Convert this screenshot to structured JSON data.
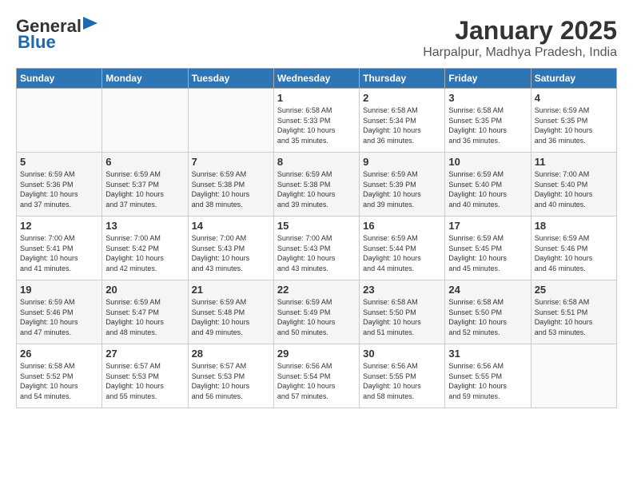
{
  "header": {
    "logo_line1": "General",
    "logo_line2": "Blue",
    "title": "January 2025",
    "subtitle": "Harpalpur, Madhya Pradesh, India"
  },
  "weekdays": [
    "Sunday",
    "Monday",
    "Tuesday",
    "Wednesday",
    "Thursday",
    "Friday",
    "Saturday"
  ],
  "weeks": [
    [
      {
        "day": "",
        "info": ""
      },
      {
        "day": "",
        "info": ""
      },
      {
        "day": "",
        "info": ""
      },
      {
        "day": "1",
        "info": "Sunrise: 6:58 AM\nSunset: 5:33 PM\nDaylight: 10 hours\nand 35 minutes."
      },
      {
        "day": "2",
        "info": "Sunrise: 6:58 AM\nSunset: 5:34 PM\nDaylight: 10 hours\nand 36 minutes."
      },
      {
        "day": "3",
        "info": "Sunrise: 6:58 AM\nSunset: 5:35 PM\nDaylight: 10 hours\nand 36 minutes."
      },
      {
        "day": "4",
        "info": "Sunrise: 6:59 AM\nSunset: 5:35 PM\nDaylight: 10 hours\nand 36 minutes."
      }
    ],
    [
      {
        "day": "5",
        "info": "Sunrise: 6:59 AM\nSunset: 5:36 PM\nDaylight: 10 hours\nand 37 minutes."
      },
      {
        "day": "6",
        "info": "Sunrise: 6:59 AM\nSunset: 5:37 PM\nDaylight: 10 hours\nand 37 minutes."
      },
      {
        "day": "7",
        "info": "Sunrise: 6:59 AM\nSunset: 5:38 PM\nDaylight: 10 hours\nand 38 minutes."
      },
      {
        "day": "8",
        "info": "Sunrise: 6:59 AM\nSunset: 5:38 PM\nDaylight: 10 hours\nand 39 minutes."
      },
      {
        "day": "9",
        "info": "Sunrise: 6:59 AM\nSunset: 5:39 PM\nDaylight: 10 hours\nand 39 minutes."
      },
      {
        "day": "10",
        "info": "Sunrise: 6:59 AM\nSunset: 5:40 PM\nDaylight: 10 hours\nand 40 minutes."
      },
      {
        "day": "11",
        "info": "Sunrise: 7:00 AM\nSunset: 5:40 PM\nDaylight: 10 hours\nand 40 minutes."
      }
    ],
    [
      {
        "day": "12",
        "info": "Sunrise: 7:00 AM\nSunset: 5:41 PM\nDaylight: 10 hours\nand 41 minutes."
      },
      {
        "day": "13",
        "info": "Sunrise: 7:00 AM\nSunset: 5:42 PM\nDaylight: 10 hours\nand 42 minutes."
      },
      {
        "day": "14",
        "info": "Sunrise: 7:00 AM\nSunset: 5:43 PM\nDaylight: 10 hours\nand 43 minutes."
      },
      {
        "day": "15",
        "info": "Sunrise: 7:00 AM\nSunset: 5:43 PM\nDaylight: 10 hours\nand 43 minutes."
      },
      {
        "day": "16",
        "info": "Sunrise: 6:59 AM\nSunset: 5:44 PM\nDaylight: 10 hours\nand 44 minutes."
      },
      {
        "day": "17",
        "info": "Sunrise: 6:59 AM\nSunset: 5:45 PM\nDaylight: 10 hours\nand 45 minutes."
      },
      {
        "day": "18",
        "info": "Sunrise: 6:59 AM\nSunset: 5:46 PM\nDaylight: 10 hours\nand 46 minutes."
      }
    ],
    [
      {
        "day": "19",
        "info": "Sunrise: 6:59 AM\nSunset: 5:46 PM\nDaylight: 10 hours\nand 47 minutes."
      },
      {
        "day": "20",
        "info": "Sunrise: 6:59 AM\nSunset: 5:47 PM\nDaylight: 10 hours\nand 48 minutes."
      },
      {
        "day": "21",
        "info": "Sunrise: 6:59 AM\nSunset: 5:48 PM\nDaylight: 10 hours\nand 49 minutes."
      },
      {
        "day": "22",
        "info": "Sunrise: 6:59 AM\nSunset: 5:49 PM\nDaylight: 10 hours\nand 50 minutes."
      },
      {
        "day": "23",
        "info": "Sunrise: 6:58 AM\nSunset: 5:50 PM\nDaylight: 10 hours\nand 51 minutes."
      },
      {
        "day": "24",
        "info": "Sunrise: 6:58 AM\nSunset: 5:50 PM\nDaylight: 10 hours\nand 52 minutes."
      },
      {
        "day": "25",
        "info": "Sunrise: 6:58 AM\nSunset: 5:51 PM\nDaylight: 10 hours\nand 53 minutes."
      }
    ],
    [
      {
        "day": "26",
        "info": "Sunrise: 6:58 AM\nSunset: 5:52 PM\nDaylight: 10 hours\nand 54 minutes."
      },
      {
        "day": "27",
        "info": "Sunrise: 6:57 AM\nSunset: 5:53 PM\nDaylight: 10 hours\nand 55 minutes."
      },
      {
        "day": "28",
        "info": "Sunrise: 6:57 AM\nSunset: 5:53 PM\nDaylight: 10 hours\nand 56 minutes."
      },
      {
        "day": "29",
        "info": "Sunrise: 6:56 AM\nSunset: 5:54 PM\nDaylight: 10 hours\nand 57 minutes."
      },
      {
        "day": "30",
        "info": "Sunrise: 6:56 AM\nSunset: 5:55 PM\nDaylight: 10 hours\nand 58 minutes."
      },
      {
        "day": "31",
        "info": "Sunrise: 6:56 AM\nSunset: 5:55 PM\nDaylight: 10 hours\nand 59 minutes."
      },
      {
        "day": "",
        "info": ""
      }
    ]
  ]
}
